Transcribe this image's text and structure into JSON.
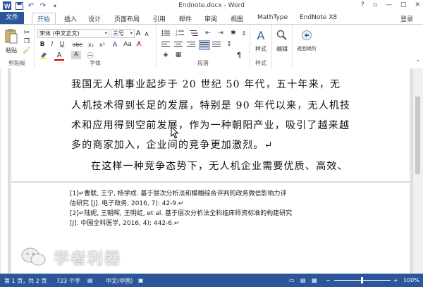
{
  "window": {
    "title": "Endnote.docx - Word",
    "controls": [
      "?",
      "▫",
      "—",
      "□",
      "✕"
    ]
  },
  "tabs": [
    "文件",
    "开始",
    "插入",
    "设计",
    "页面布局",
    "引用",
    "邮件",
    "审阅",
    "视图",
    "MathType",
    "EndNote X8"
  ],
  "login": "登录",
  "ribbon": {
    "clipboard": {
      "label": "剪贴板",
      "paste": "粘贴"
    },
    "font": {
      "label": "字体",
      "name": "宋体 (中文正文)",
      "size": "三号",
      "bold": "B",
      "italic": "I",
      "underline": "U",
      "abc": "abc",
      "x2": "x₂",
      "x2sup": "x²",
      "fontcolor": "A",
      "aa": "Aa",
      "grow": "A",
      "shrink": "A"
    },
    "paragraph": {
      "label": "段落"
    },
    "styles": {
      "label": "样式",
      "button": "样式"
    },
    "editing": {
      "button": "编辑"
    },
    "return": {
      "button": "返回尚阶"
    }
  },
  "document": {
    "lines": [
      "我国无人机事业起步于 20 世纪 50 年代，五十年来，无",
      "人机技术得到长足的发展，特别是 90 年代以来，无人机技",
      "术和应用得到空前发展，作为一种朝阳产业，吸引了越来越",
      "多的商家加入，企业间的竞争更加激烈。↵",
      "在这样一种竞争态势下，无人机企业需要优质、高效、"
    ],
    "footnotes": [
      "[1]↵曹联, 王宁, 杨学成. 基于层次分析法和模糊综合评判的政务微信影响力评",
      "估研究 [J]. 电子政务, 2016, 7): 42-9.↵",
      "[2]↵陆妮, 王朝晖, 王明虹, et al. 基于层次分析法全科临床师资标准的构建研究",
      "[J]. 中国全科医学, 2016, 4): 442-6.↵"
    ],
    "watermark": "学者利器"
  },
  "status": {
    "page": "第 1 页，共 2 页",
    "words": "723 个字",
    "language": "中文(中国)",
    "zoom": "100%"
  },
  "colors": {
    "accent": "#2b579a",
    "ribbon_bg": "#ffffff",
    "doc_bg": "#e3e3e3"
  }
}
